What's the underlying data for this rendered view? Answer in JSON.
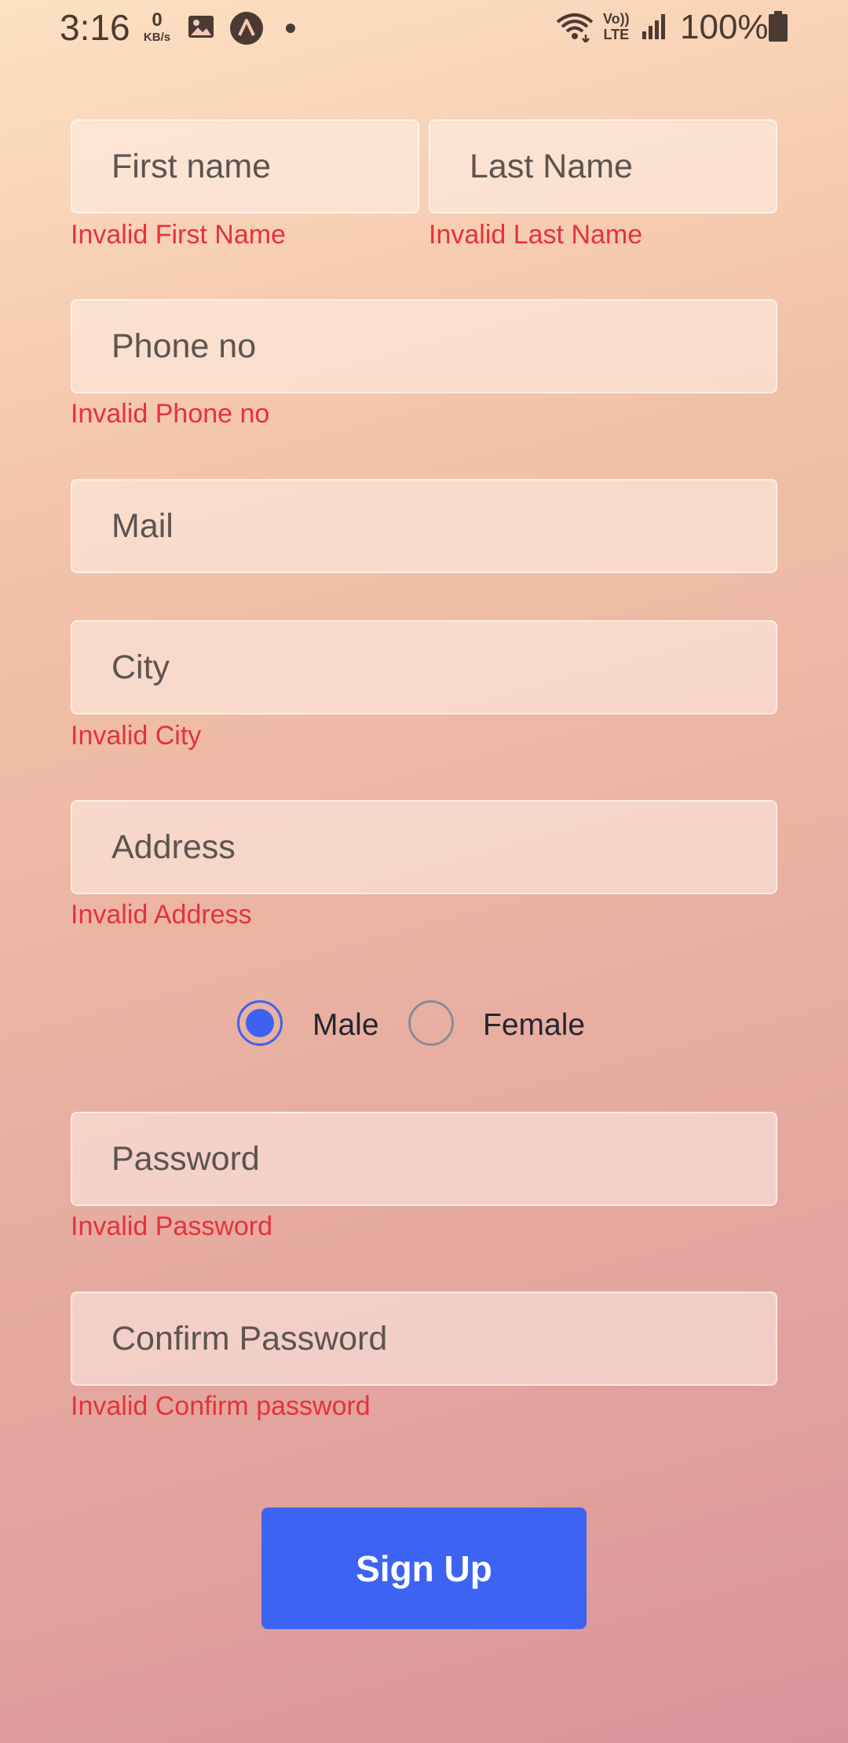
{
  "status_bar": {
    "time": "3:16",
    "net_speed_value": "0",
    "net_speed_unit": "KB/s",
    "volte_line1": "Vo))",
    "volte_line2": "LTE",
    "battery": "100%"
  },
  "form": {
    "first_name": {
      "placeholder": "First name",
      "error": "Invalid First Name"
    },
    "last_name": {
      "placeholder": "Last Name",
      "error": "Invalid Last Name"
    },
    "phone": {
      "placeholder": "Phone no",
      "error": "Invalid Phone no"
    },
    "mail": {
      "placeholder": "Mail"
    },
    "city": {
      "placeholder": "City",
      "error": "Invalid City"
    },
    "address": {
      "placeholder": "Address",
      "error": "Invalid Address"
    },
    "gender": {
      "options": [
        "Male",
        "Female"
      ],
      "selected": "Male"
    },
    "password": {
      "placeholder": "Password",
      "error": "Invalid Password"
    },
    "confirm_password": {
      "placeholder": "Confirm Password",
      "error": "Invalid Confirm password"
    },
    "submit_label": "Sign Up"
  },
  "colors": {
    "accent": "#3d63f3",
    "error": "#e5323a"
  }
}
